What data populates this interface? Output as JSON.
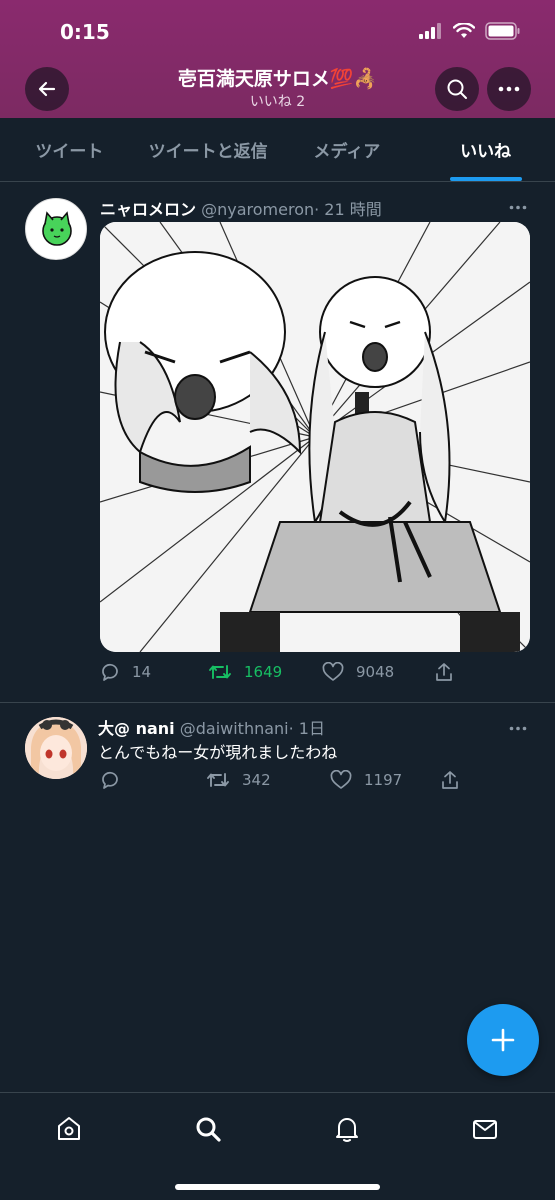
{
  "status_bar": {
    "time": "0:15"
  },
  "header": {
    "title": "壱百満天原サロメ💯🦂",
    "subtitle": "いいね 2"
  },
  "tabs": [
    {
      "label": "ツイート"
    },
    {
      "label": "ツイートと返信"
    },
    {
      "label": "メディア"
    },
    {
      "label": "いいね",
      "active": true
    }
  ],
  "tweets": [
    {
      "name": "ニャロメロン",
      "handle": "@nyaromeron",
      "time": "· 21 時間",
      "text": "",
      "replies": "14",
      "retweets": "1649",
      "likes": "9048",
      "retweeted": true
    },
    {
      "name": "大@ nani",
      "handle": "@daiwithnani",
      "time": "· 1日",
      "text": "とんでもねー女が現れましたわね",
      "replies": "",
      "retweets": "342",
      "likes": "1197",
      "retweeted": false
    }
  ],
  "icons": {
    "back": "arrow-left-icon",
    "search": "search-icon",
    "more": "more-icon",
    "compose": "plus-icon",
    "nav": [
      "home-icon",
      "search-icon",
      "bell-icon",
      "mail-icon"
    ]
  },
  "colors": {
    "accent": "#1d9bf0",
    "retweet": "#17bf63",
    "header": "#7c2a62",
    "background": "#15202b"
  }
}
